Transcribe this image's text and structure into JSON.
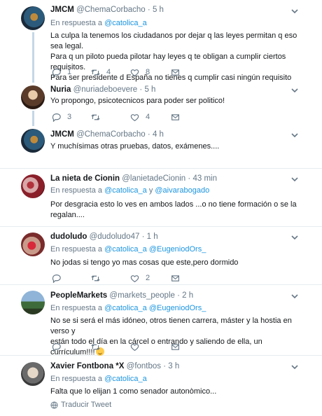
{
  "tweets": [
    {
      "name": "JMCM",
      "handle": "@ChemaCorbacho",
      "dot": "·",
      "time": "5 h",
      "reply_prefix": "En respuesta a",
      "reply_to": [
        "@catolica_a"
      ],
      "lines": [
        "La culpa la tenemos los ciudadanos por dejar q las leyes permitan q eso sea legal.",
        "Para q un piloto pueda pilotar hay leyes q te obligan a cumplir ciertos requisitos.",
        "Para ser presidente d España no tienes q cumplir casi ningún requisito"
      ],
      "replies": "1",
      "retweets": "4",
      "likes": "8"
    },
    {
      "name": "Nuria",
      "handle": "@nuriadeboevere",
      "dot": "·",
      "time": "5 h",
      "lines": [
        "Yo propongo, psicotecnicos para poder ser politico!"
      ],
      "replies": "3",
      "retweets": "",
      "likes": "4"
    },
    {
      "name": "JMCM",
      "handle": "@ChemaCorbacho",
      "dot": "·",
      "time": "4 h",
      "lines": [
        "Y muchísimas otras pruebas, datos, exámenes...."
      ],
      "replies": "",
      "retweets": "",
      "likes": ""
    },
    {
      "name": "La nieta de Cionin",
      "handle": "@lanietadeCionin",
      "dot": "·",
      "time": "43 min",
      "reply_prefix": "En respuesta a",
      "reply_to": [
        "@catolica_a",
        "@aivarabogado"
      ],
      "reply_joiner": "y",
      "lines": [
        "Por desgracia esto lo ves en ambos lados ...o no tiene formación o se la regalan...."
      ],
      "replies": "",
      "retweets": "",
      "likes": ""
    },
    {
      "name": "dudoludo",
      "handle": "@dudoludo47",
      "dot": "·",
      "time": "1 h",
      "reply_prefix": "En respuesta a",
      "reply_to": [
        "@catolica_a",
        "@EugeniodOrs_"
      ],
      "lines": [
        "No jodas si tengo yo mas cosas que este,pero dormido"
      ],
      "replies": "",
      "retweets": "",
      "likes": "2"
    },
    {
      "name": "PeopleMarkets",
      "handle": "@markets_people",
      "dot": "·",
      "time": "2 h",
      "reply_prefix": "En respuesta a",
      "reply_to": [
        "@catolica_a",
        "@EugeniodOrs_"
      ],
      "lines": [
        "No se si será el más idóneo, otros tienen carrera, máster y la hostia en verso y",
        "están todo el día en la cárcel o entrando y saliendo de ella, un currículum!!!!"
      ],
      "replies": "",
      "retweets": "",
      "likes": ""
    },
    {
      "name": "Xavier Fontbona *X",
      "handle": "@fontbos",
      "dot": "·",
      "time": "3 h",
      "reply_prefix": "En respuesta a",
      "reply_to": [
        "@catolica_a"
      ],
      "lines": [
        "Falta que lo elijan 1 como senador autonòmico..."
      ],
      "translate": "Traducir Tweet"
    }
  ],
  "icons": {
    "reply": "reply-icon",
    "retweet": "retweet-icon",
    "like": "heart-icon",
    "dm": "envelope-icon",
    "more": "chevron-down-icon",
    "translate": "globe-icon"
  },
  "colors": {
    "link": "#1b95e0",
    "muted": "#657786",
    "thread": "#c4d7e6"
  }
}
